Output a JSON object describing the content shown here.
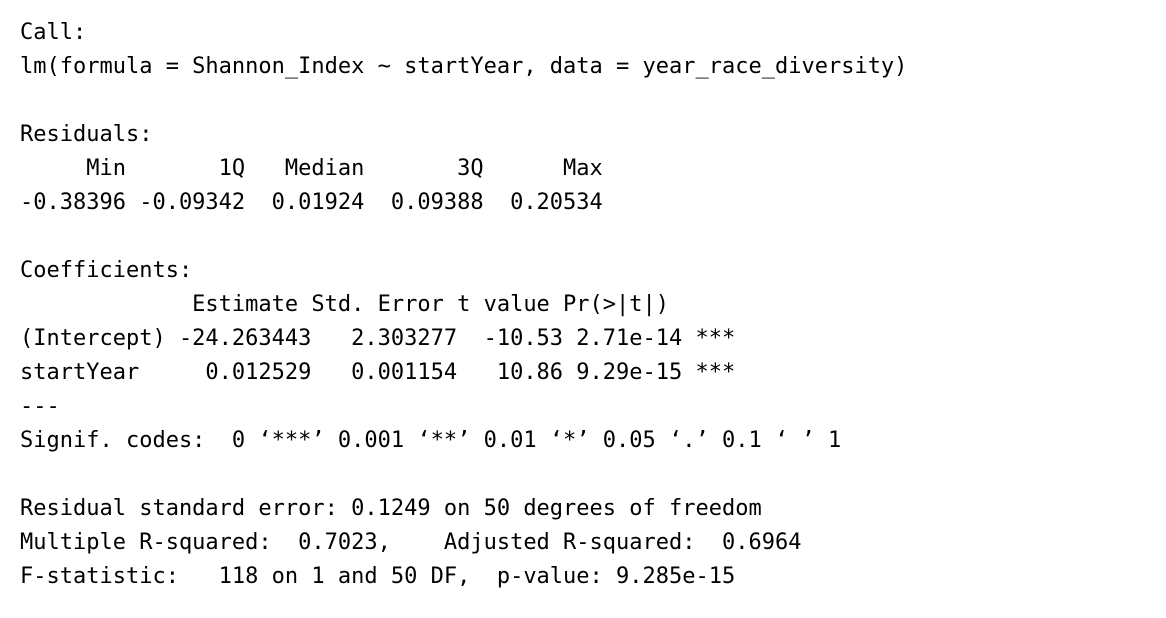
{
  "console": {
    "call_header": "Call:",
    "call_formula": "lm(formula = Shannon_Index ~ startYear, data = year_race_diversity)",
    "residuals_header": "Residuals:",
    "residuals_labels": "     Min       1Q   Median       3Q      Max ",
    "residuals_values": "-0.38396 -0.09342  0.01924  0.09388  0.20534 ",
    "coefficients_header": "Coefficients:",
    "coefficients_columns": "             Estimate Std. Error t value Pr(>|t|)    ",
    "coef_intercept": "(Intercept) -24.263443   2.303277  -10.53 2.71e-14 ***",
    "coef_startyear": "startYear     0.012529   0.001154   10.86 9.29e-15 ***",
    "separator": "---",
    "signif_codes": "Signif. codes:  0 ‘***’ 0.001 ‘**’ 0.01 ‘*’ 0.05 ‘.’ 0.1 ‘ ’ 1",
    "residual_se": "Residual standard error: 0.1249 on 50 degrees of freedom",
    "r_squared": "Multiple R-squared:  0.7023,\tAdjusted R-squared:  0.6964 ",
    "f_statistic": "F-statistic:   118 on 1 and 50 DF,  p-value: 9.285e-15"
  }
}
